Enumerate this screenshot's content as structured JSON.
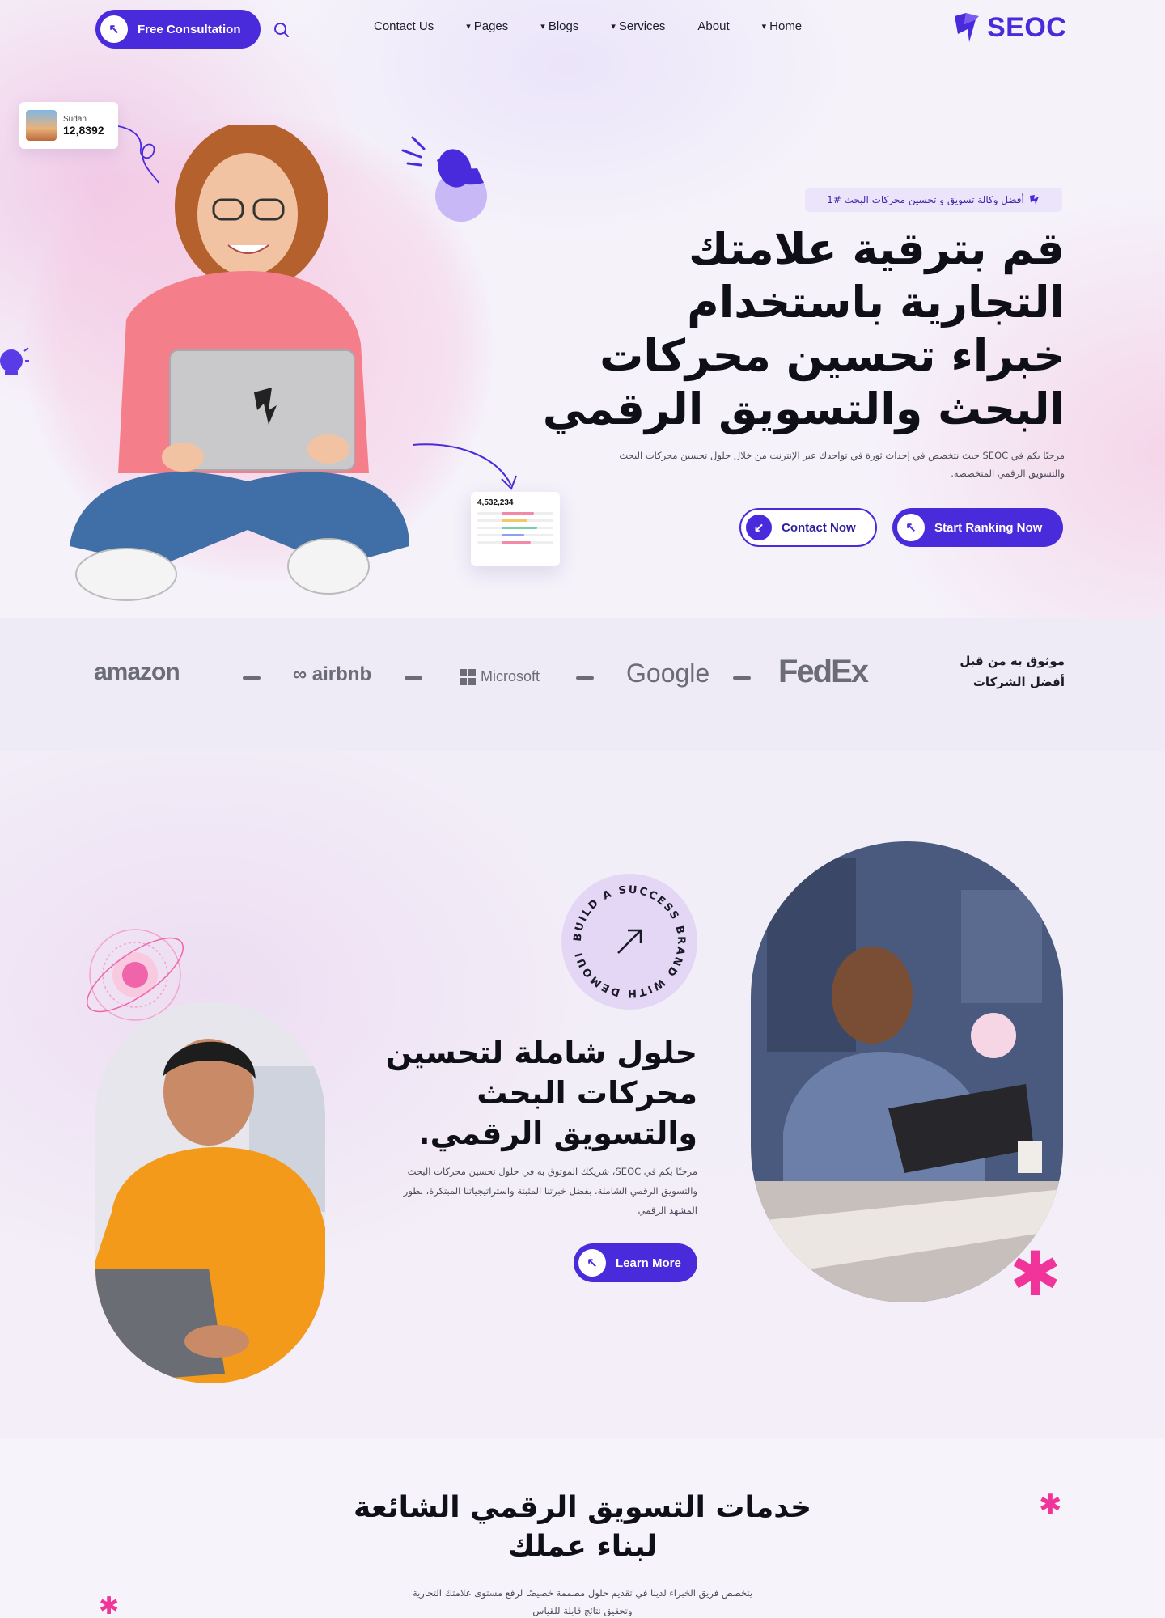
{
  "nav": {
    "consult_label": "Free Consultation",
    "links": [
      "Contact Us",
      "Pages",
      "Blogs",
      "Services",
      "About",
      "Home"
    ],
    "logo_text": "SEOC"
  },
  "hero": {
    "stat_card": {
      "label": "Sudan",
      "value": "12,8392"
    },
    "mini_card": {
      "value": "4,532,234"
    },
    "badge": "أفضل وكالة تسويق و تحسين محركات البحث #1",
    "title_lines": [
      "قم بترقية علامتك",
      "التجارية باستخدام",
      "خبراء تحسين محركات",
      "البحث والتسويق الرقمي"
    ],
    "description": "مرحبًا بكم في SEOC حيث نتخصص في إحداث ثورة في تواجدك عبر الإنترنت من خلال حلول تحسين محركات البحث والتسويق الرقمي المتخصصة.",
    "contact_label": "Contact Now",
    "start_label": "Start Ranking Now"
  },
  "logos": {
    "trusted_lines": [
      "موثوق به من قبل",
      "أفضل الشركات"
    ],
    "brands": [
      "amazon",
      "airbnb",
      "Microsoft",
      "Google",
      "FedEx"
    ]
  },
  "about": {
    "rotor_text": "BUILD A SUCCESS BRAND WITH DEMOUI",
    "title_lines": [
      "حلول شاملة لتحسين",
      "محركات البحث",
      "والتسويق الرقمي."
    ],
    "description": "مرحبًا بكم في SEOC، شريكك الموثوق به في حلول تحسين محركات البحث والتسويق الرقمي الشاملة. بفضل خبرتنا المثبتة واستراتيجياتنا المبتكرة، نطور المشهد الرقمي",
    "button_label": "Learn More"
  },
  "services": {
    "title_lines": [
      "خدمات التسويق الرقمي الشائعة",
      "لبناء عملك"
    ],
    "description": "يتخصص فريق الخبراء لدينا في تقديم حلول مصممة خصيصًا لرفع مستوى علامتك التجارية وتحقيق نتائج قابلة للقياس"
  },
  "colors": {
    "accent": "#4a2bdc",
    "pink": "#f0349a",
    "bg": "#f6f4fa"
  }
}
